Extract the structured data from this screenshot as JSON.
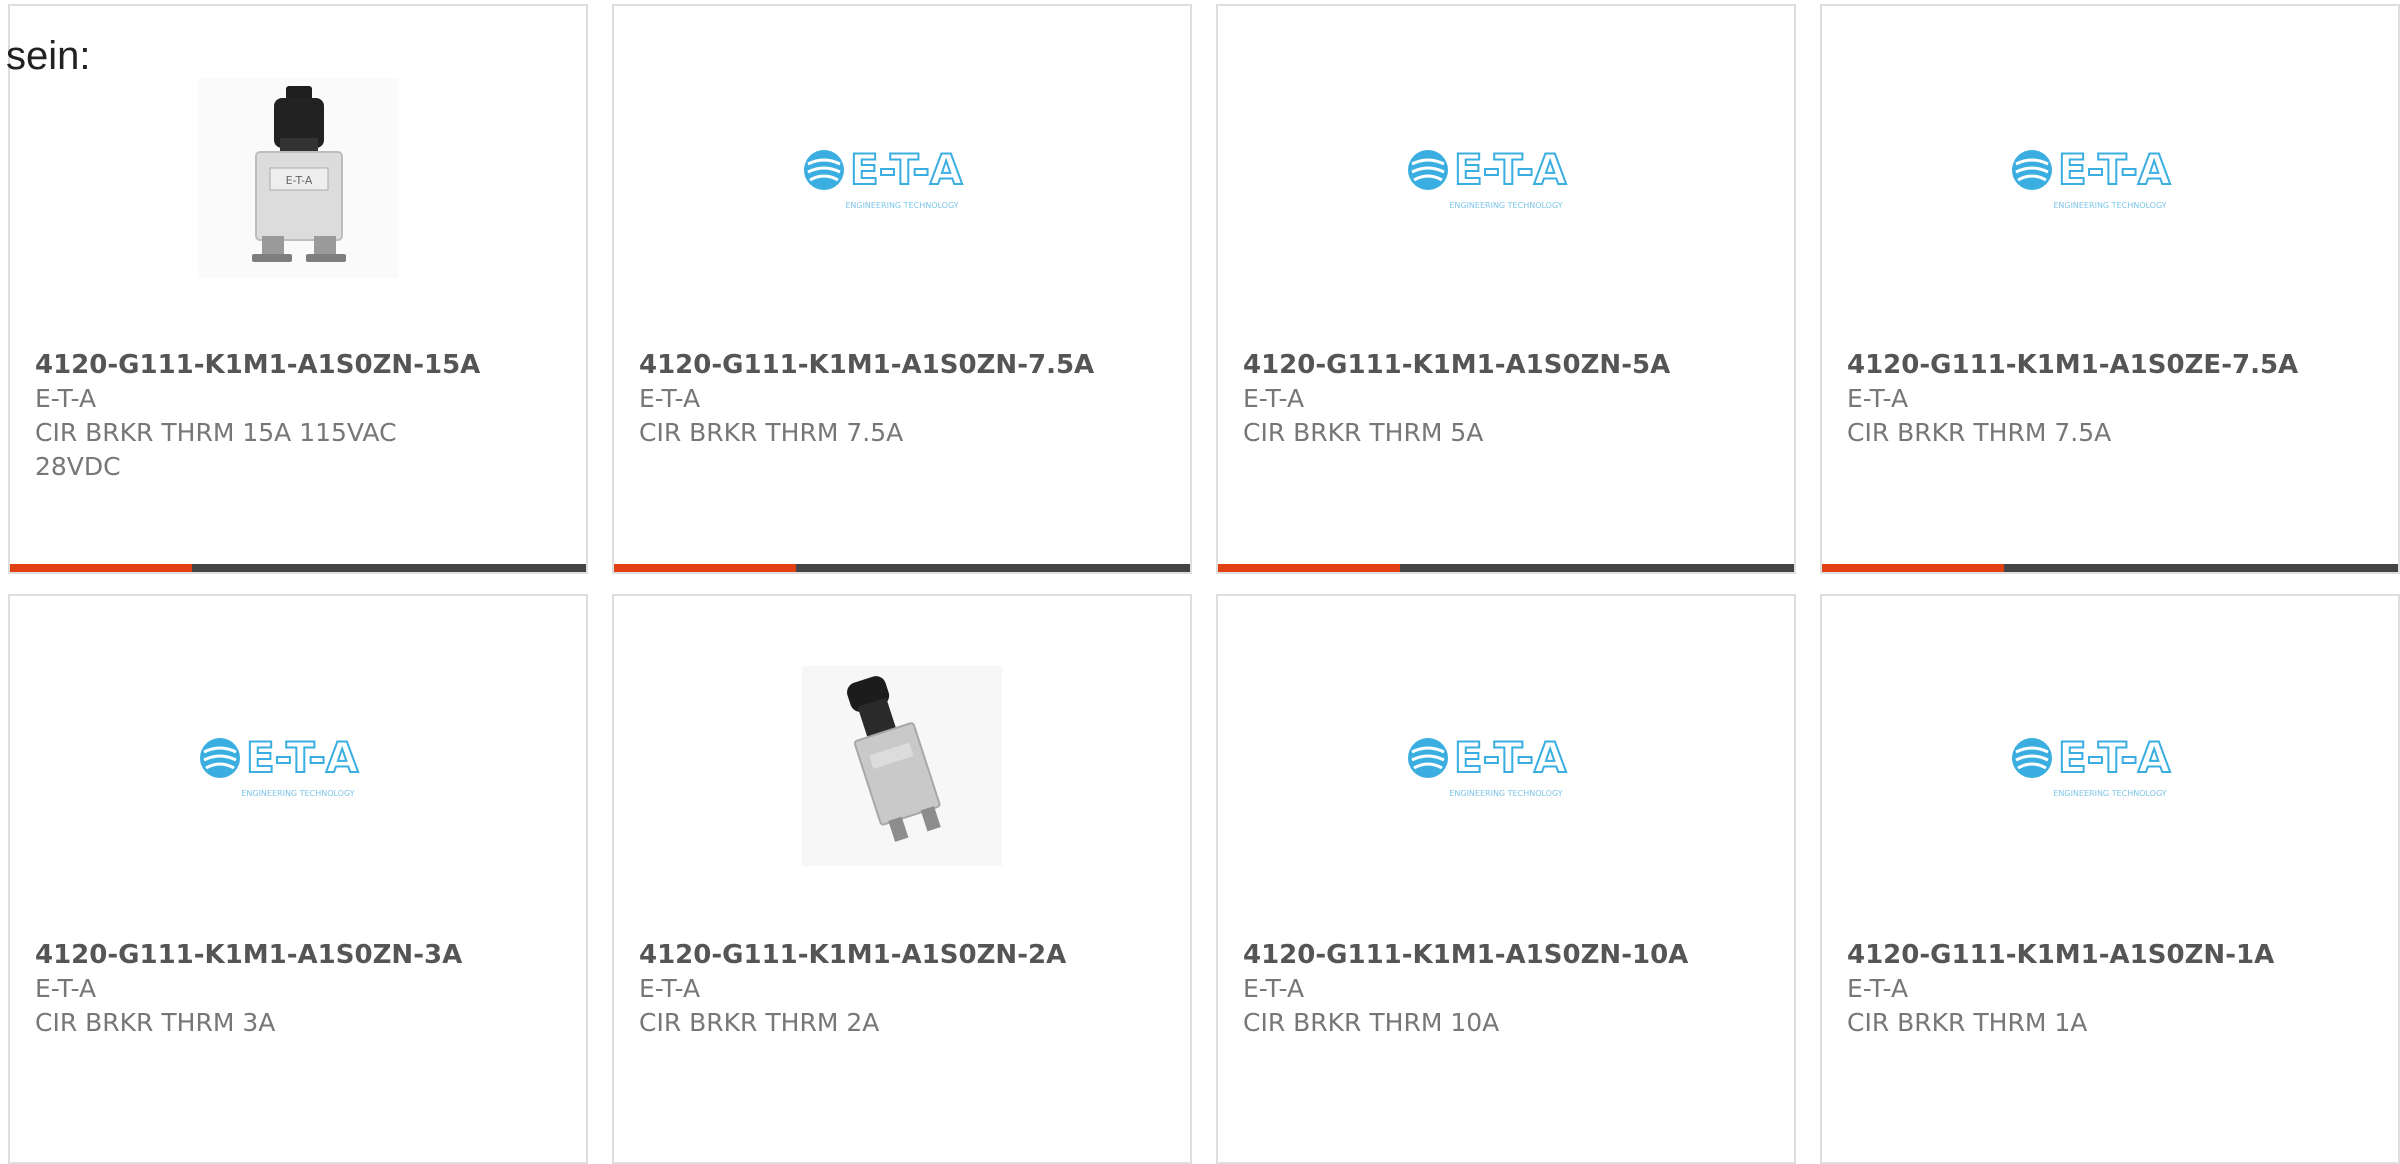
{
  "intro_text": "sein:",
  "accent_color": "#e23f12",
  "bar_color": "#444444",
  "logo": {
    "text": "E-T-A",
    "subtitle": "ENGINEERING TECHNOLOGY",
    "color": "#3aaee0"
  },
  "products": [
    {
      "part_number": "4120-G111-K1M1-A1S0ZN-15A",
      "manufacturer": "E-T-A",
      "description": "CIR BRKR THRM 15A 115VAC 28VDC",
      "image": "breaker-photo-front"
    },
    {
      "part_number": "4120-G111-K1M1-A1S0ZN-7.5A",
      "manufacturer": "E-T-A",
      "description": "CIR BRKR THRM 7.5A",
      "image": "eta-logo"
    },
    {
      "part_number": "4120-G111-K1M1-A1S0ZN-5A",
      "manufacturer": "E-T-A",
      "description": "CIR BRKR THRM 5A",
      "image": "eta-logo"
    },
    {
      "part_number": "4120-G111-K1M1-A1S0ZE-7.5A",
      "manufacturer": "E-T-A",
      "description": "CIR BRKR THRM 7.5A",
      "image": "eta-logo"
    },
    {
      "part_number": "4120-G111-K1M1-A1S0ZN-3A",
      "manufacturer": "E-T-A",
      "description": "CIR BRKR THRM 3A",
      "image": "eta-logo"
    },
    {
      "part_number": "4120-G111-K1M1-A1S0ZN-2A",
      "manufacturer": "E-T-A",
      "description": "CIR BRKR THRM 2A",
      "image": "breaker-photo-angled"
    },
    {
      "part_number": "4120-G111-K1M1-A1S0ZN-10A",
      "manufacturer": "E-T-A",
      "description": "CIR BRKR THRM 10A",
      "image": "eta-logo"
    },
    {
      "part_number": "4120-G111-K1M1-A1S0ZN-1A",
      "manufacturer": "E-T-A",
      "description": "CIR BRKR THRM 1A",
      "image": "eta-logo"
    }
  ]
}
